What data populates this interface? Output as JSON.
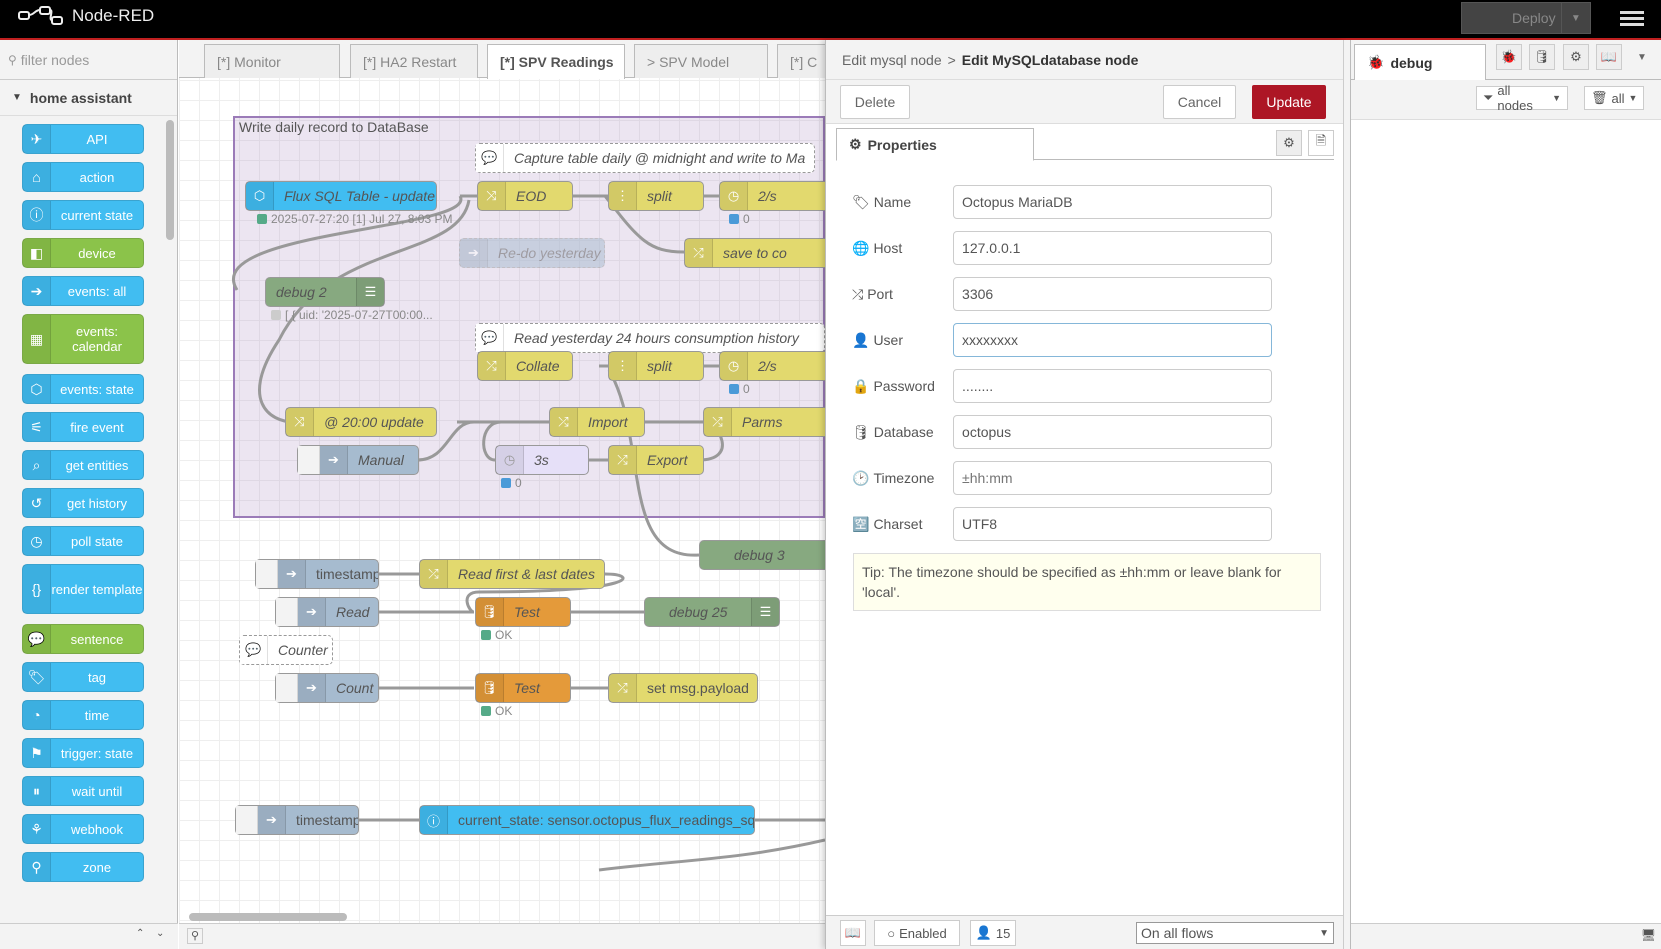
{
  "app": {
    "title": "Node-RED",
    "deploy_label": "Deploy"
  },
  "palette": {
    "filter_placeholder": "filter nodes",
    "category": "home assistant",
    "nodes": [
      {
        "label": "API",
        "icon": "paper-plane-icon",
        "color": "blue"
      },
      {
        "label": "action",
        "icon": "router-icon",
        "color": "blue"
      },
      {
        "label": "current state",
        "icon": "info-icon",
        "color": "blue"
      },
      {
        "label": "device",
        "icon": "cube-icon",
        "color": "green"
      },
      {
        "label": "events: all",
        "icon": "arrow-right-icon",
        "color": "blue"
      },
      {
        "label": "events: calendar",
        "icon": "calendar-icon",
        "color": "green"
      },
      {
        "label": "events: state",
        "icon": "hexagon-arrow-icon",
        "color": "blue"
      },
      {
        "label": "fire event",
        "icon": "broadcast-icon",
        "color": "blue"
      },
      {
        "label": "get entities",
        "icon": "search-doc-icon",
        "color": "blue"
      },
      {
        "label": "get history",
        "icon": "history-icon",
        "color": "blue"
      },
      {
        "label": "poll state",
        "icon": "timer-icon",
        "color": "blue"
      },
      {
        "label": "render template",
        "icon": "braces-icon",
        "color": "blue"
      },
      {
        "label": "sentence",
        "icon": "speech-bubble-icon",
        "color": "green"
      },
      {
        "label": "tag",
        "icon": "tag-icon",
        "color": "blue"
      },
      {
        "label": "time",
        "icon": "clock-icon",
        "color": "blue"
      },
      {
        "label": "trigger: state",
        "icon": "signpost-icon",
        "color": "blue"
      },
      {
        "label": "wait until",
        "icon": "pause-icon",
        "color": "blue"
      },
      {
        "label": "webhook",
        "icon": "webhook-icon",
        "color": "blue"
      },
      {
        "label": "zone",
        "icon": "map-pin-icon",
        "color": "blue"
      }
    ]
  },
  "workspace": {
    "tabs": [
      "[*] Monitor",
      "[*] HA2 Restart",
      "[*] SPV Readings",
      "> SPV Model",
      "[*] C"
    ],
    "group_label": "Write daily record to DataBase",
    "nodes": {
      "flux": "Flux SQL Table - update",
      "flux_status": "2025-07-27:20 [1] Jul 27, 8:03 PM",
      "capture": "Capture table daily @ midnight and write to Ma",
      "eod": "EOD",
      "split1": "split",
      "rate1": "2/s",
      "rate1_status": "0",
      "redo": "Re-do yesterday",
      "save": "save to co",
      "debug2": "debug 2",
      "debug2_status": "[ { uid: '2025-07-27T00:00...",
      "read_yesterday": "Read yesterday 24 hours consumption history",
      "collate": "Collate",
      "split2": "split",
      "rate2": "2/s",
      "rate2_status": "0",
      "at2000": "@ 20:00 update",
      "import": "Import",
      "parms": "Parms",
      "manual": "Manual",
      "delay3s": "3s",
      "delay_status": "0",
      "export": "Export",
      "debug3": "debug 3",
      "timestamp1": "timestamp",
      "read_first": "Read first & last dates",
      "read": "Read",
      "test1": "Test",
      "test1_status": "OK",
      "debug25": "debug 25",
      "counter": "Counter",
      "count": "Count",
      "test2": "Test",
      "test2_status": "OK",
      "setpayload": "set msg.payload",
      "timestamp2": "timestamp",
      "current_state": "current_state: sensor.octopus_flux_readings_sql"
    }
  },
  "editor": {
    "breadcrumb_parent": "Edit mysql node",
    "breadcrumb_sep": ">",
    "title": "Edit MySQLdatabase node",
    "delete_label": "Delete",
    "cancel_label": "Cancel",
    "update_label": "Update",
    "properties_tab": "Properties",
    "fields": {
      "name": {
        "label": "Name",
        "value": "Octopus MariaDB"
      },
      "host": {
        "label": "Host",
        "value": "127.0.0.1"
      },
      "port": {
        "label": "Port",
        "value": "3306"
      },
      "user": {
        "label": "User",
        "value": "xxxxxxxx"
      },
      "password": {
        "label": "Password",
        "value": "........"
      },
      "database": {
        "label": "Database",
        "value": "octopus"
      },
      "timezone": {
        "label": "Timezone",
        "value": "",
        "placeholder": "±hh:mm"
      },
      "charset": {
        "label": "Charset",
        "value": "UTF8"
      }
    },
    "tip": "Tip: The timezone should be specified as ±hh:mm or leave blank for 'local'.",
    "footer": {
      "enabled_label": "Enabled",
      "users_count": "15",
      "scope": "On all flows"
    }
  },
  "sidebar": {
    "tab": "debug",
    "filter_nodes": "all nodes",
    "clear": "all"
  },
  "colors": {
    "accent": "#ad1625",
    "header": "#000000",
    "group_border": "#9b7bb8"
  }
}
